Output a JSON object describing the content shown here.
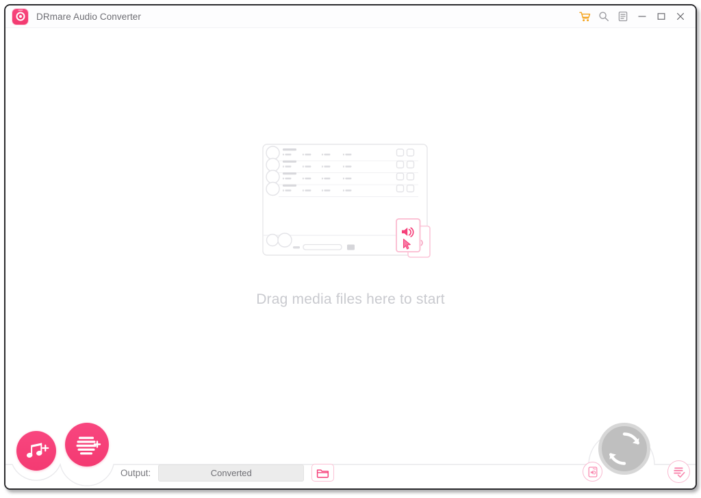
{
  "window": {
    "title": "DRmare Audio Converter",
    "app_icon": "record-disc-icon",
    "controls": [
      {
        "name": "cart-icon",
        "label": "Shopping cart",
        "color": "#f5a623"
      },
      {
        "name": "search-icon",
        "label": "Search",
        "color": "#9a9a9f"
      },
      {
        "name": "menu-list-icon",
        "label": "Menu",
        "color": "#9a9a9f"
      },
      {
        "name": "minimize-icon",
        "label": "Minimize",
        "color": "#6f6f74"
      },
      {
        "name": "maximize-icon",
        "label": "Maximize",
        "color": "#6f6f74"
      },
      {
        "name": "close-icon",
        "label": "Close",
        "color": "#6f6f74"
      }
    ]
  },
  "dropzone": {
    "message": "Drag media files here to start",
    "illustration": {
      "name": "drag-media-illustration",
      "rows": 4,
      "row_columns": 4,
      "row_checkboxes": 2,
      "cards": 2,
      "card_icon": "speaker-icon",
      "cursor_icon": "cursor-arrow-icon"
    }
  },
  "bottombar": {
    "add_files_button": {
      "label": "Add files",
      "icon": "music-note-plus-icon"
    },
    "add_list_button": {
      "label": "Add list",
      "icon": "playlist-plus-icon"
    },
    "output_label": "Output:",
    "output_path": "Converted",
    "output_path_placeholder": "Converted",
    "browse_button": {
      "label": "Browse output folder",
      "icon": "folder-icon"
    },
    "convert_button": {
      "label": "Convert",
      "icon": "refresh-circle-icon",
      "enabled": false
    },
    "edit_audio_button": {
      "label": "Edit audio",
      "icon": "audio-file-edit-icon"
    },
    "history_button": {
      "label": "Converted history",
      "icon": "list-check-icon"
    }
  },
  "theme": {
    "accent": "#f5407a",
    "accent_light": "#fbc2d5",
    "cart_orange": "#f5a623",
    "text_muted": "#77777c",
    "placeholder_gray": "#c9cacf",
    "wireframe_gray": "#e7e7ea",
    "convert_gray": "#bfbfbf"
  }
}
